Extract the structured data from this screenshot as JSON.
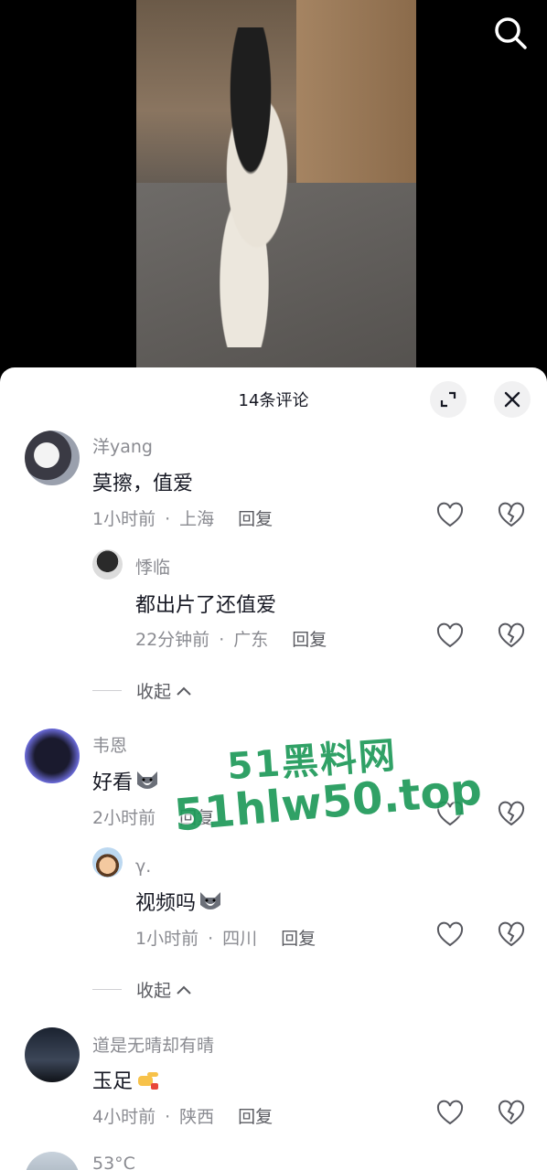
{
  "header": {
    "comment_count_title": "14条评论"
  },
  "comments": [
    {
      "user": "洋yang",
      "text": "莫擦，值爱",
      "time": "1小时前",
      "location": "上海",
      "reply_label": "回复",
      "replies": [
        {
          "user": "悸临",
          "text": "都出片了还值爱",
          "time": "22分钟前",
          "location": "广东",
          "reply_label": "回复"
        }
      ],
      "collapse_label": "收起"
    },
    {
      "user": "韦恩",
      "text": "好看",
      "emoji": "husky-emoji",
      "time": "2小时前",
      "reply_label": "回复",
      "replies": [
        {
          "user": "γ.",
          "text": "视频吗",
          "emoji": "husky-emoji",
          "time": "1小时前",
          "location": "四川",
          "reply_label": "回复"
        }
      ],
      "collapse_label": "收起"
    },
    {
      "user": "道是无晴却有晴",
      "text": "玉足",
      "emoji": "pointing-hand-emoji",
      "time": "4小时前",
      "location": "陕西",
      "reply_label": "回复"
    },
    {
      "user": "53°C"
    }
  ],
  "watermark": {
    "line1": "51黑料网",
    "line2": "51hlw50.top"
  },
  "colors": {
    "watermark": "#1f9a5a",
    "meta_gray": "#8a8b91",
    "text": "#161823"
  }
}
